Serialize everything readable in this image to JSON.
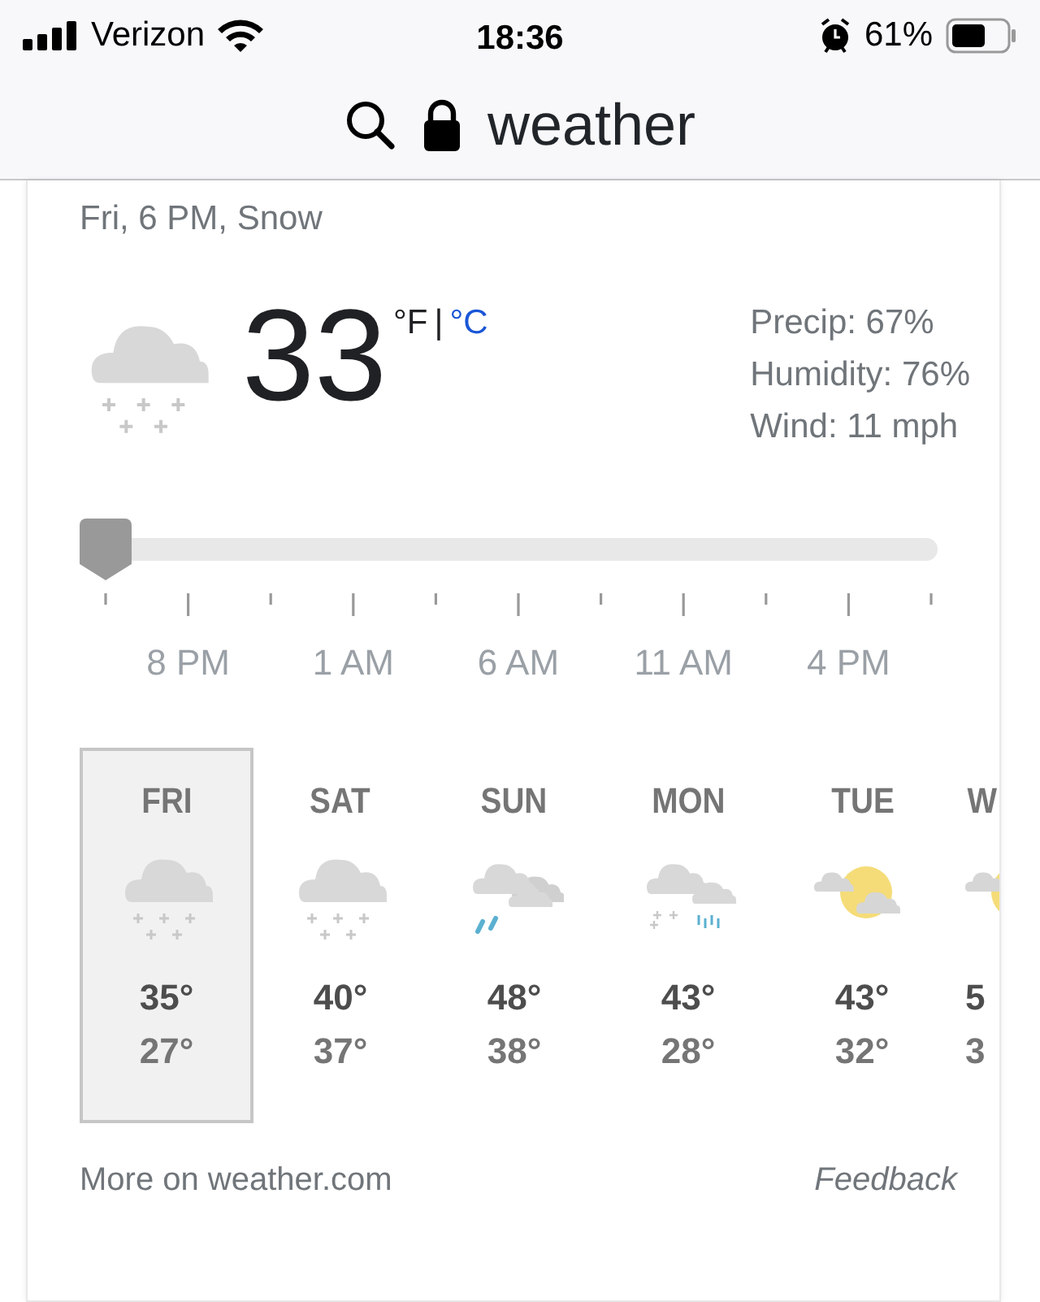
{
  "status_bar": {
    "carrier": "Verizon",
    "time": "18:36",
    "battery": "61%"
  },
  "address_bar": {
    "query": "weather"
  },
  "weather": {
    "subtitle": "Fri, 6 PM, Snow",
    "kind": "snow",
    "temperature": "33",
    "units": [
      {
        "label": "°F",
        "selected": true
      },
      {
        "label": "°C",
        "selected": false
      }
    ],
    "unit_separator": "|",
    "details": [
      "Precip: 67%",
      "Humidity: 76%",
      "Wind: 11 mph"
    ],
    "timeline": {
      "level": 0,
      "labels": [
        "8 PM",
        "1 AM",
        "6 AM",
        "11 AM",
        "4 PM"
      ]
    },
    "days": [
      {
        "day": "FRI",
        "kind": "snow",
        "high": "35°",
        "low": "27°",
        "selected": true
      },
      {
        "day": "SAT",
        "kind": "snow",
        "high": "40°",
        "low": "37°",
        "selected": false
      },
      {
        "day": "SUN",
        "kind": "rain",
        "high": "48°",
        "low": "38°",
        "selected": false
      },
      {
        "day": "MON",
        "kind": "mix",
        "high": "43°",
        "low": "28°",
        "selected": false
      },
      {
        "day": "TUE",
        "kind": "sun",
        "high": "43°",
        "low": "32°",
        "selected": false
      },
      {
        "day": "W",
        "kind": "sun",
        "high": "5",
        "low": "3",
        "selected": false
      }
    ],
    "more_link": "More on weather.com",
    "feedback": "Feedback"
  }
}
